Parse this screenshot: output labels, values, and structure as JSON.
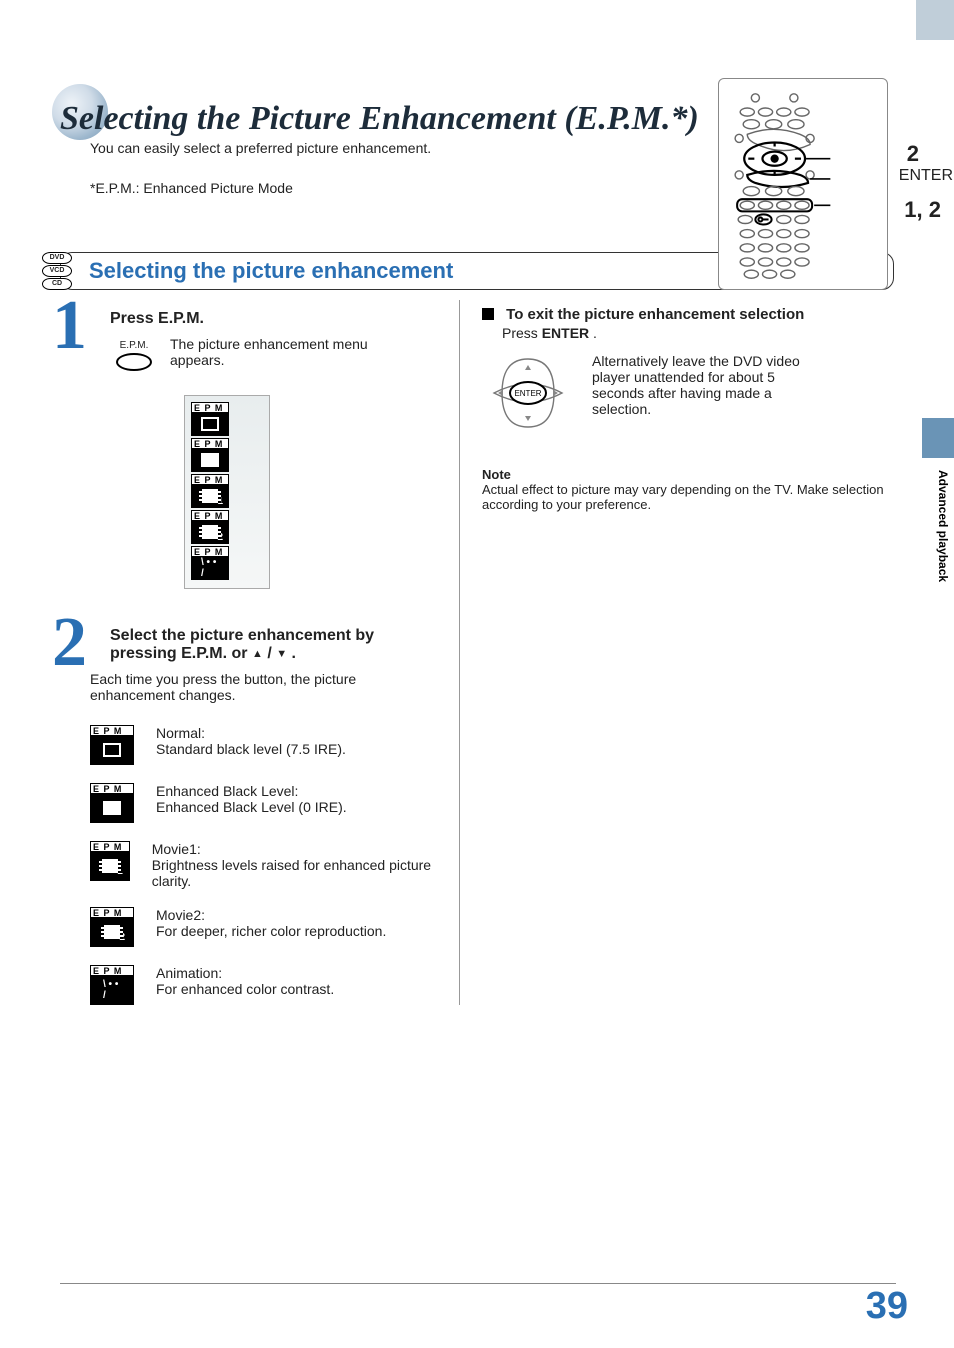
{
  "page": {
    "title": "Selecting the Picture Enhancement (E.P.M.*)",
    "subtitle": "You can easily select a preferred picture enhancement.",
    "epm_footnote": "*E.P.M.: Enhanced Picture Mode",
    "section_heading": "Selecting the picture enhancement",
    "discs": [
      "DVD",
      "VCD",
      "CD"
    ],
    "page_number": "39",
    "side_tab": "Advanced playback"
  },
  "remote": {
    "callout_2": "2",
    "callout_enter": "ENTER",
    "callout_12": "1, 2"
  },
  "steps": {
    "step1": {
      "num": "1",
      "title": "Press E.P.M.",
      "button_label": "E.P.M.",
      "body": "The picture enhancement menu appears."
    },
    "step2": {
      "num": "2",
      "title_a": "Select the picture enhancement by",
      "title_b": "pressing E.P.M. or ",
      "title_c": " / ",
      "title_d": ".",
      "body": "Each time you press the button, the picture enhancement changes."
    }
  },
  "epm_label": "E P M",
  "options": [
    {
      "name": "Normal:",
      "desc": "Standard black level (7.5 IRE).",
      "kind": "hollow"
    },
    {
      "name": "Enhanced Black Level:",
      "desc": "Enhanced Black Level (0 IRE).",
      "kind": "fill"
    },
    {
      "name": "Movie1:",
      "desc": "Brightness levels raised for enhanced picture clarity.",
      "kind": "film",
      "corner": "1"
    },
    {
      "name": "Movie2:",
      "desc": "For deeper, richer color reproduction.",
      "kind": "film",
      "corner": "2"
    },
    {
      "name": "Animation:",
      "desc": "For enhanced color contrast.",
      "kind": "anim",
      "corner": "\\ • • /"
    }
  ],
  "right": {
    "exit_title": "To exit the picture enhancement selection",
    "exit_press": "Press ",
    "exit_enter": "ENTER",
    "exit_dot": ".",
    "enter_label": "ENTER",
    "exit_body": "Alternatively leave the DVD video player unattended for about 5 seconds after having made a selection.",
    "note_h": "Note",
    "note_t": "Actual effect to picture may vary depending on the TV.  Make selection according to your preference."
  }
}
